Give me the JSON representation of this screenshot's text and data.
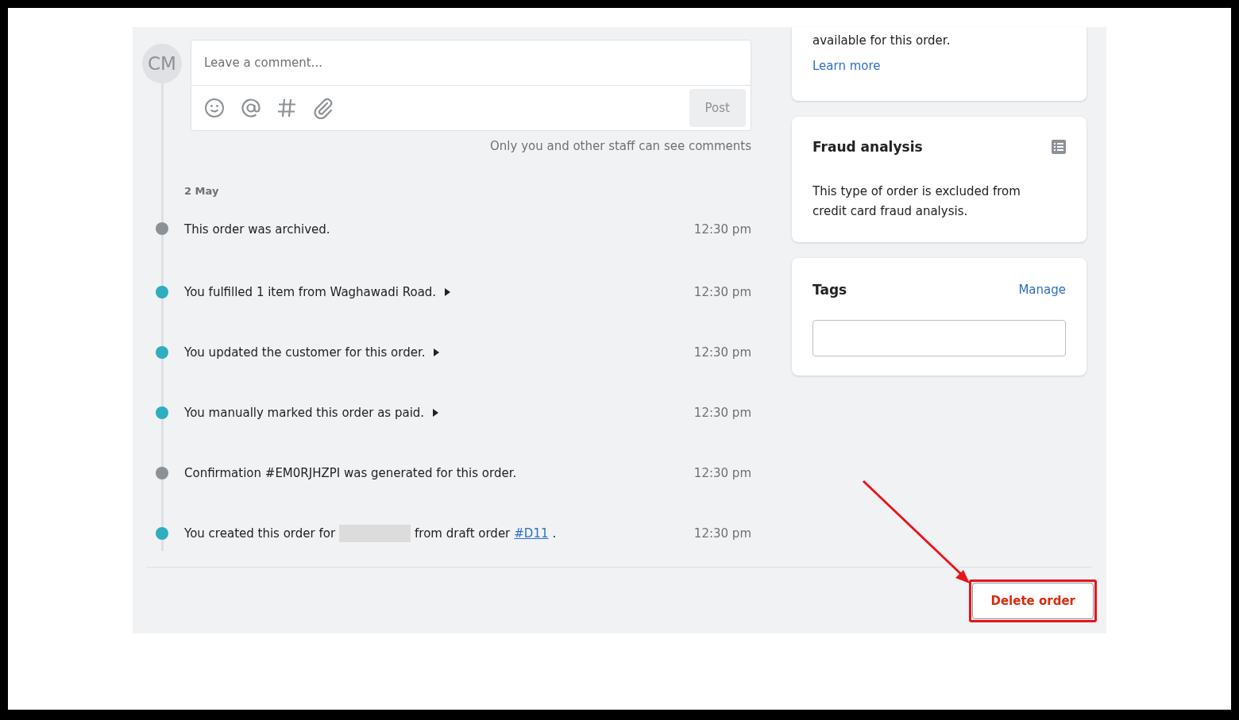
{
  "comment": {
    "avatar": "CM",
    "placeholder": "Leave a comment...",
    "post": "Post",
    "note": "Only you and other staff can see comments"
  },
  "date": "2 May",
  "events": [
    {
      "kind": "plain",
      "text": "This order was archived.",
      "time": "12:30 pm",
      "color": "#8c9196",
      "expandable": false
    },
    {
      "kind": "plain",
      "text": "You fulfilled 1 item from Waghawadi Road.",
      "time": "12:30 pm",
      "color": "#2eaebf",
      "expandable": true
    },
    {
      "kind": "plain",
      "text": "You updated the customer for this order.",
      "time": "12:30 pm",
      "color": "#2eaebf",
      "expandable": true
    },
    {
      "kind": "plain",
      "text": "You manually marked this order as paid.",
      "time": "12:30 pm",
      "color": "#2eaebf",
      "expandable": true
    },
    {
      "kind": "plain",
      "text": "Confirmation #EM0RJHZPI was generated for this order.",
      "time": "12:30 pm",
      "color": "#8c9196",
      "expandable": false
    },
    {
      "kind": "draft",
      "text": "You created this order for",
      "after": "from draft order",
      "link": "#D11",
      "end": ".",
      "time": "12:30 pm",
      "color": "#2eaebf",
      "expandable": false
    }
  ],
  "conversion": {
    "text": "available for this order.",
    "link": "Learn more"
  },
  "fraud": {
    "title": "Fraud analysis",
    "text": "This type of order is excluded from credit card fraud analysis."
  },
  "tags": {
    "title": "Tags",
    "action": "Manage"
  },
  "delete_button": "Delete order"
}
